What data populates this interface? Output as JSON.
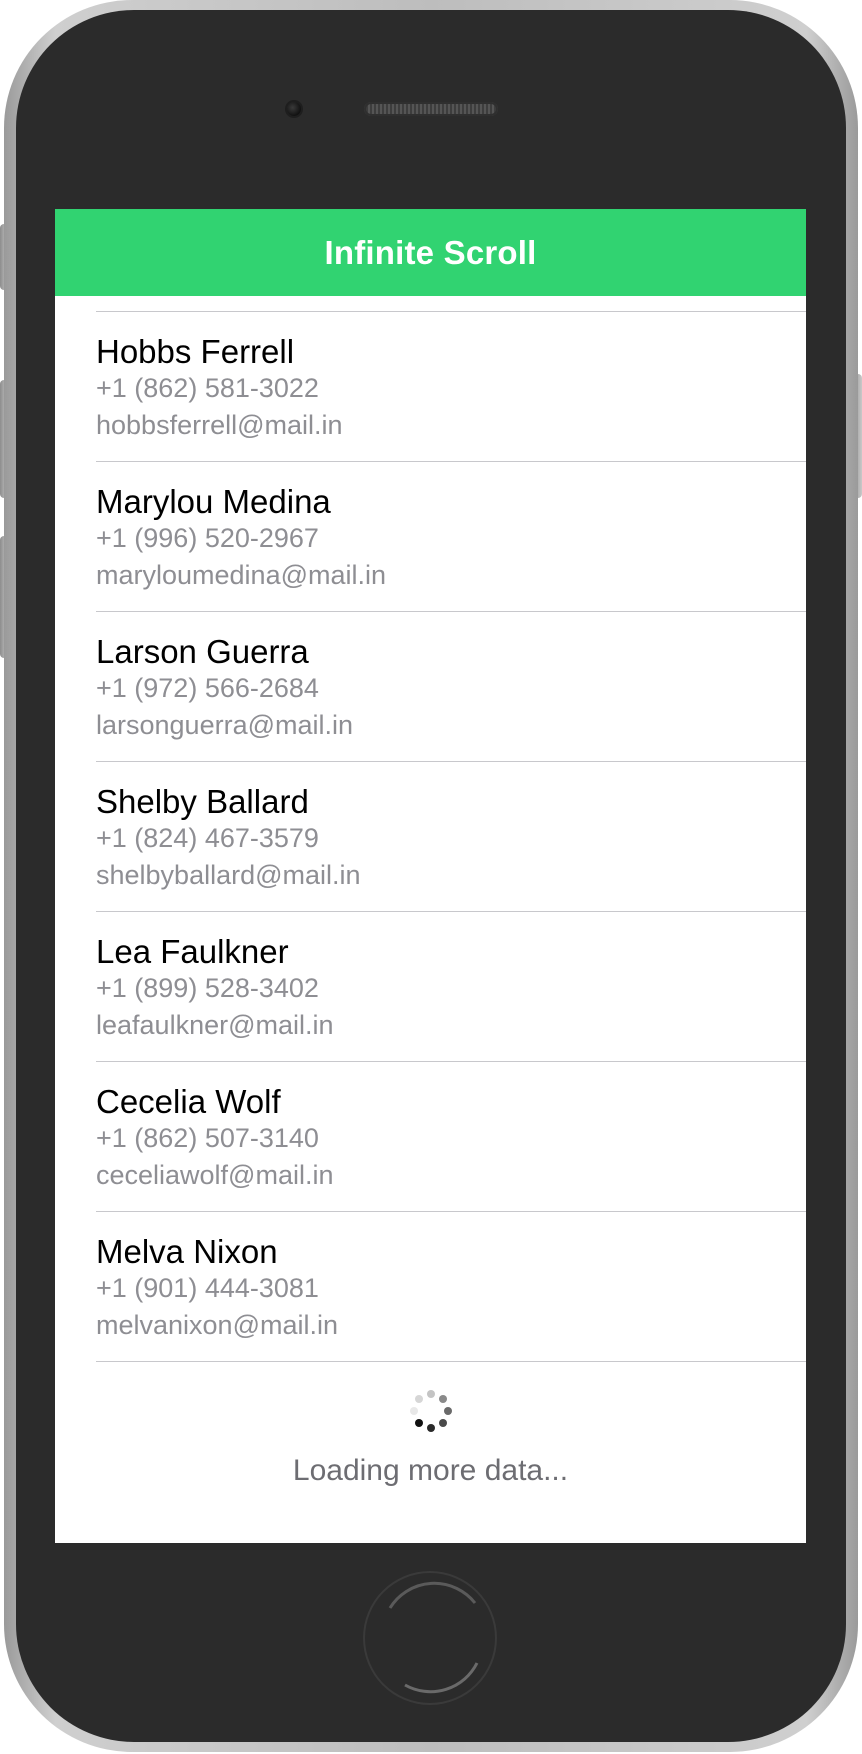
{
  "app": {
    "title": "Infinite Scroll",
    "accent_color": "#31d371"
  },
  "contacts": [
    {
      "name": "Hobbs Ferrell",
      "phone": "+1 (862) 581-3022",
      "email": "hobbsferrell@mail.in"
    },
    {
      "name": "Marylou Medina",
      "phone": "+1 (996) 520-2967",
      "email": "maryloumedina@mail.in"
    },
    {
      "name": "Larson Guerra",
      "phone": "+1 (972) 566-2684",
      "email": "larsonguerra@mail.in"
    },
    {
      "name": "Shelby Ballard",
      "phone": "+1 (824) 467-3579",
      "email": "shelbyballard@mail.in"
    },
    {
      "name": "Lea Faulkner",
      "phone": "+1 (899) 528-3402",
      "email": "leafaulkner@mail.in"
    },
    {
      "name": "Cecelia Wolf",
      "phone": "+1 (862) 507-3140",
      "email": "ceceliawolf@mail.in"
    },
    {
      "name": "Melva Nixon",
      "phone": "+1 (901) 444-3081",
      "email": "melvanixon@mail.in"
    }
  ],
  "loader": {
    "text": "Loading more data...",
    "icon": "spinner-icon"
  },
  "device": {
    "home_button_icon": "home-button-icon",
    "camera_icon": "camera-icon",
    "speaker_icon": "speaker-grille-icon"
  }
}
